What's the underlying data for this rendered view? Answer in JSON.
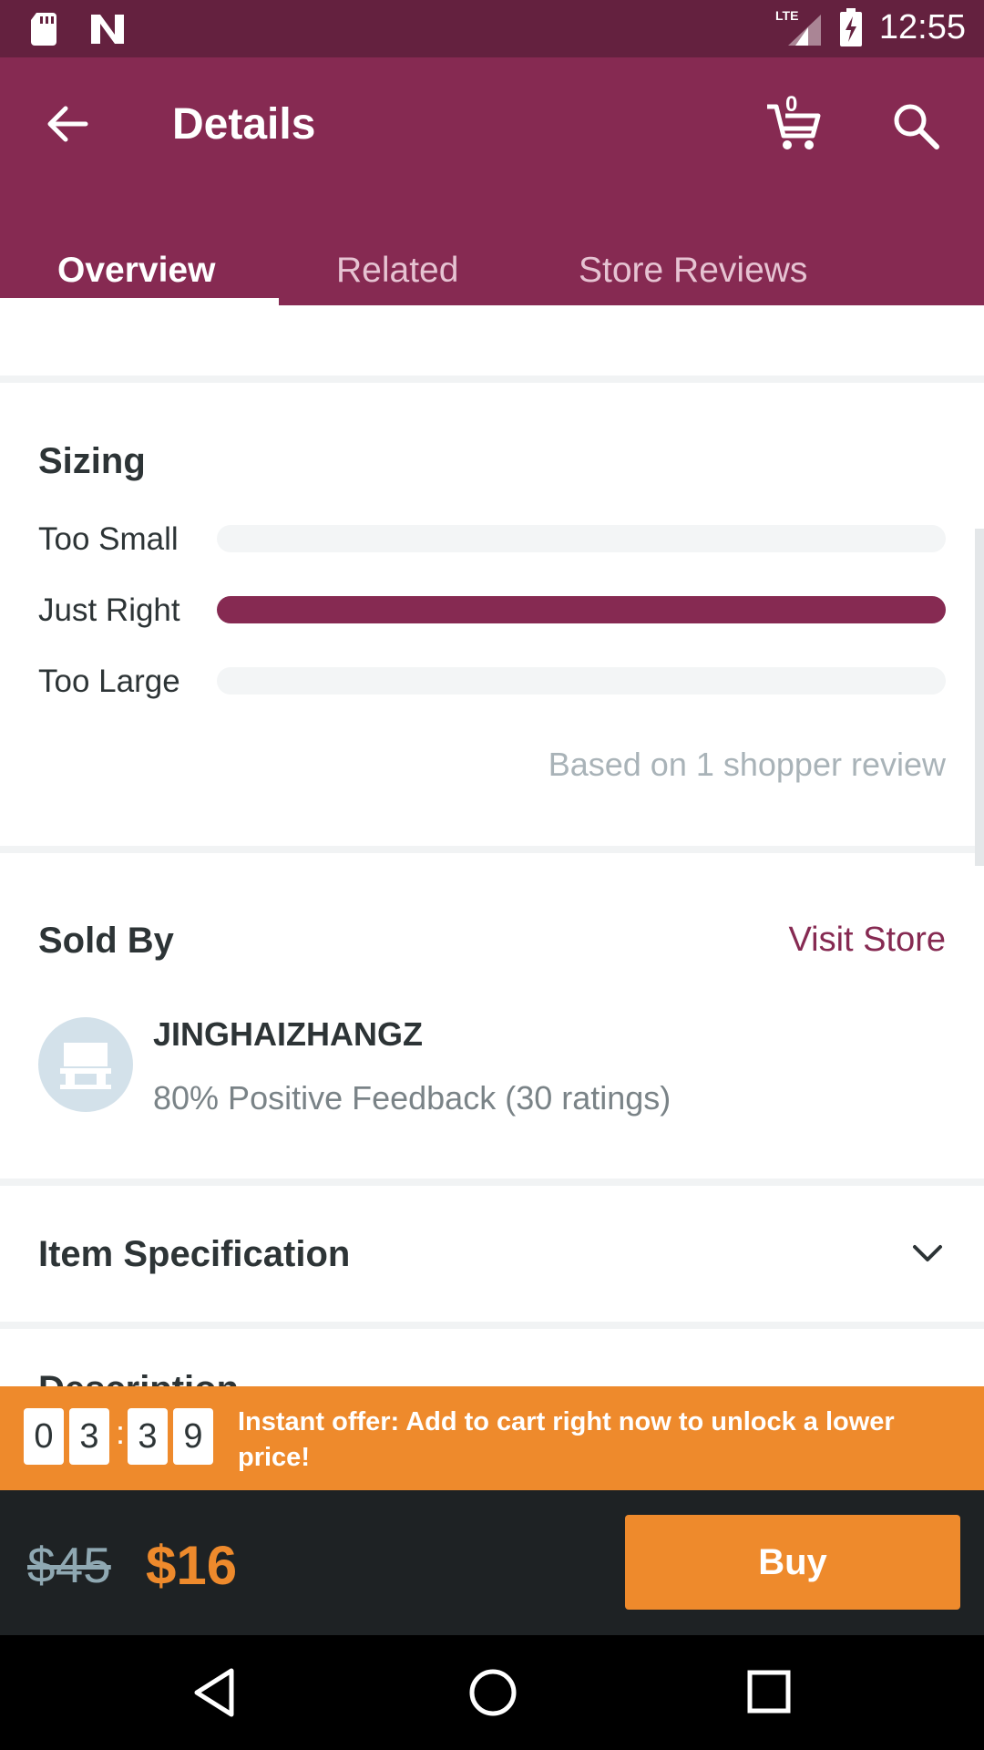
{
  "status_bar": {
    "time": "12:55",
    "network": "LTE"
  },
  "app_bar": {
    "title": "Details",
    "cart_count": "0"
  },
  "tabs": [
    {
      "label": "Overview",
      "active": true
    },
    {
      "label": "Related",
      "active": false
    },
    {
      "label": "Store Reviews",
      "active": false
    }
  ],
  "sizing": {
    "title": "Sizing",
    "rows": [
      {
        "label": "Too Small",
        "fill": 0.0
      },
      {
        "label": "Just Right",
        "fill": 1.0
      },
      {
        "label": "Too Large",
        "fill": 0.0
      }
    ],
    "note": "Based on 1 shopper review"
  },
  "sold_by": {
    "title": "Sold By",
    "visit_store": "Visit Store",
    "seller_name": "JINGHAIZHANGZ",
    "feedback": "80% Positive Feedback (30 ratings)"
  },
  "item_spec": {
    "title": "Item Specification"
  },
  "description_partial": "Description",
  "offer": {
    "timer_digits": [
      "0",
      "3",
      "3",
      "9"
    ],
    "timer_separator": ":",
    "text": "Instant offer: Add to cart right now to unlock a lower price!"
  },
  "price_bar": {
    "old_price": "$45",
    "new_price": "$16",
    "buy_label": "Buy"
  },
  "colors": {
    "primary": "#862a52",
    "status_bar": "#64213f",
    "accent": "#ee8a2c",
    "dark": "#1e2224"
  }
}
